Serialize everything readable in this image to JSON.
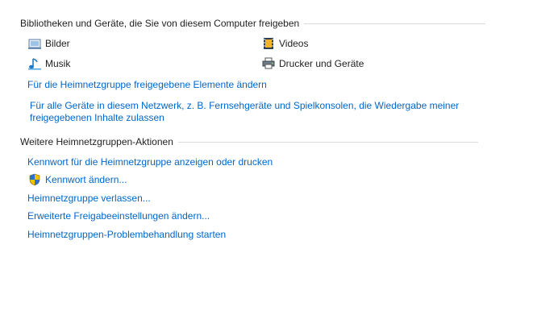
{
  "libraries_section": {
    "title": "Bibliotheken und Geräte, die Sie von diesem Computer freigeben",
    "items": [
      {
        "label": "Bilder",
        "icon": "pictures-library-icon"
      },
      {
        "label": "Videos",
        "icon": "videos-library-icon"
      },
      {
        "label": "Musik",
        "icon": "music-library-icon"
      },
      {
        "label": "Drucker und Geräte",
        "icon": "printer-icon"
      }
    ],
    "change_shared_link": "Für die Heimnetzgruppe freigegebene Elemente ändern",
    "allow_devices_link": "Für alle Geräte in diesem Netzwerk, z. B. Fernsehgeräte und Spielkonsolen, die Wiedergabe meiner freigegebenen Inhalte zulassen"
  },
  "actions_section": {
    "title": "Weitere Heimnetzgruppen-Aktionen",
    "links": [
      {
        "label": "Kennwort für die Heimnetzgruppe anzeigen oder drucken"
      },
      {
        "label": "Kennwort ändern...",
        "icon": "uac-shield-icon"
      },
      {
        "label": "Heimnetzgruppe verlassen..."
      },
      {
        "label": "Erweiterte Freigabeeinstellungen ändern..."
      },
      {
        "label": "Heimnetzgruppen-Problembehandlung starten"
      }
    ]
  },
  "colors": {
    "link": "#0066cc",
    "text": "#1e1e1e",
    "rule": "#d9d9d9",
    "background": "#ffffff"
  }
}
